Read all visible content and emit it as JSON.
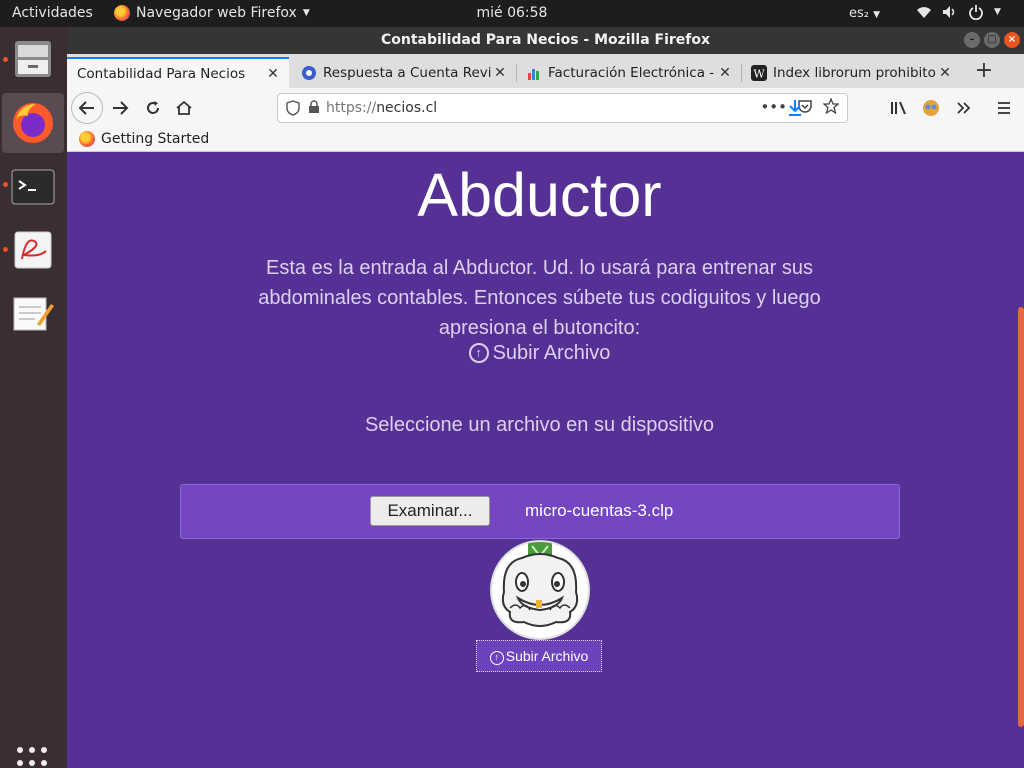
{
  "topbar": {
    "activities": "Actividades",
    "app_name": "Navegador web Firefox",
    "clock": "mié 06:58",
    "language": "es₂"
  },
  "dock": {
    "items": [
      "file-cabinet-icon",
      "firefox-icon",
      "terminal-icon",
      "pdf-viewer-icon",
      "text-editor-icon"
    ],
    "show_apps": "show-applications-icon"
  },
  "window": {
    "title": "Contabilidad Para Necios - Mozilla Firefox"
  },
  "tabs": [
    {
      "title": "Contabilidad Para Necios",
      "active": true
    },
    {
      "title": "Respuesta a Cuenta Revi",
      "active": false
    },
    {
      "title": "Facturación Electrónica -",
      "active": false
    },
    {
      "title": "Index librorum prohibito",
      "active": false
    }
  ],
  "navbar": {
    "url_scheme": "https://",
    "url_host": "necios.cl"
  },
  "bookmarks": {
    "getting_started": "Getting Started"
  },
  "page": {
    "title": "Abductor",
    "intro": "Esta es la entrada al Abductor. Ud. lo usará para entrenar sus abdominales contables. Entonces súbete tus codiguitos y luego apresiona el butoncito:",
    "upload_link": "Subir Archivo",
    "select_message": "Seleccione un archivo en su dispositivo",
    "browse_label": "Examinar...",
    "file_name": "micro-cuentas-3.clp",
    "submit_label": "Subir Archivo"
  },
  "colors": {
    "page_bg": "#553195",
    "file_row_bg": "#7446c2",
    "accent": "#e95420",
    "tab_active_line": "#0a84ff"
  }
}
